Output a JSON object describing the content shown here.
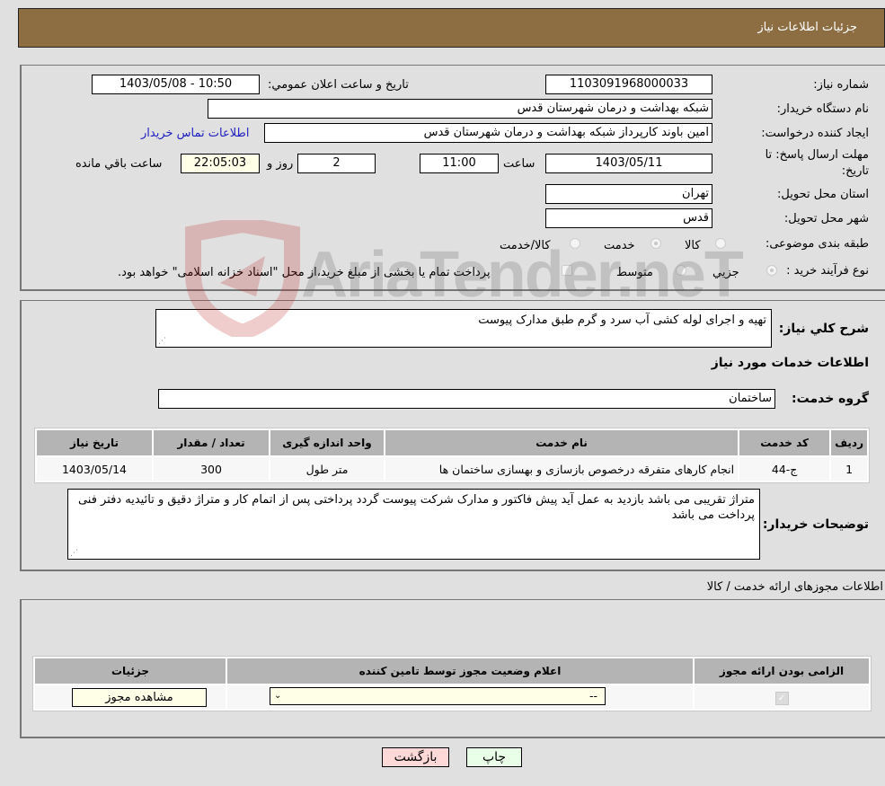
{
  "header": {
    "title": "جزئیات اطلاعات نیاز"
  },
  "form": {
    "need_number_label": "شماره نیاز:",
    "need_number": "1103091968000033",
    "announce_label": "تاریخ و ساعت اعلان عمومي:",
    "announce_value": "1403/05/08 - 10:50",
    "buyer_label": "نام دستگاه خریدار:",
    "buyer_value": "شبکه بهداشت و درمان شهرستان قدس",
    "creator_label": "ایجاد کننده درخواست:",
    "creator_value": "امین باوند کارپرداز شبکه بهداشت و درمان شهرستان قدس",
    "contact_link": "اطلاعات تماس خریدار",
    "deadline_label_1": "مهلت ارسال پاسخ: تا",
    "deadline_label_2": "تاریخ:",
    "deadline_date": "1403/05/11",
    "time_label": "ساعت",
    "deadline_time": "11:00",
    "days_value": "2",
    "days_label": "روز و",
    "remaining_time": "22:05:03",
    "remaining_label": "ساعت باقي مانده",
    "province_label": "استان محل تحویل:",
    "province_value": "تهران",
    "city_label": "شهر محل تحویل:",
    "city_value": "قدس",
    "category_label": "طبقه بندی موضوعی:",
    "category_options": [
      "کالا",
      "خدمت",
      "کالا/خدمت"
    ],
    "category_selected": "خدمت",
    "process_label": "نوع فرآیند خرید :",
    "process_options": [
      "جزيي",
      "متوسط"
    ],
    "process_selected": "جزيي",
    "treasury_text": "پرداخت تمام یا بخشی از مبلغ خرید،از محل \"اسناد خزانه اسلامی\" خواهد بود."
  },
  "description": {
    "label": "شرح کلي نیاز:",
    "value": "تهیه و اجرای لوله کشی آب سرد و گرم طبق مدارک پیوست"
  },
  "services": {
    "section_title": "اطلاعات خدمات مورد نیاز",
    "group_label": "گروه خدمت:",
    "group_value": "ساختمان",
    "columns": [
      "ردیف",
      "کد خدمت",
      "نام خدمت",
      "واحد اندازه گیری",
      "تعداد / مقدار",
      "تاریخ نیاز"
    ],
    "rows": [
      [
        "1",
        "ج-44",
        "انجام کارهای متفرقه درخصوص بازسازی و بهسازی ساختمان ها",
        "متر طول",
        "300",
        "1403/05/14"
      ]
    ]
  },
  "buyer_notes": {
    "label": "توضیحات خریدار:",
    "value": "متراژ تقریبی می باشد بازدید به عمل آید پیش فاکتور و مدارک شرکت پیوست گردد پرداختی پس از اتمام کار و متراژ دقیق  و تائیدیه دفتر فنی پرداخت می باشد"
  },
  "permits": {
    "section_title": "اطلاعات مجوزهای ارائه خدمت / کالا",
    "columns": [
      "الزامی بودن ارائه مجوز",
      "اعلام وضعیت مجوز توسط تامین کننده",
      "جزئیات"
    ],
    "row": {
      "required": true,
      "status_value": "--",
      "view_button": "مشاهده مجوز"
    }
  },
  "footer": {
    "print_button": "چاپ",
    "back_button": "بازگشت"
  },
  "watermark": {
    "text": "AriaTender.neT"
  },
  "colors": {
    "header_bg": "#8d6e43",
    "link": "#2020c0",
    "back_bg": "#ffd8d8",
    "print_bg": "#eaffe8",
    "readonly_bg": "#ffffe8"
  }
}
